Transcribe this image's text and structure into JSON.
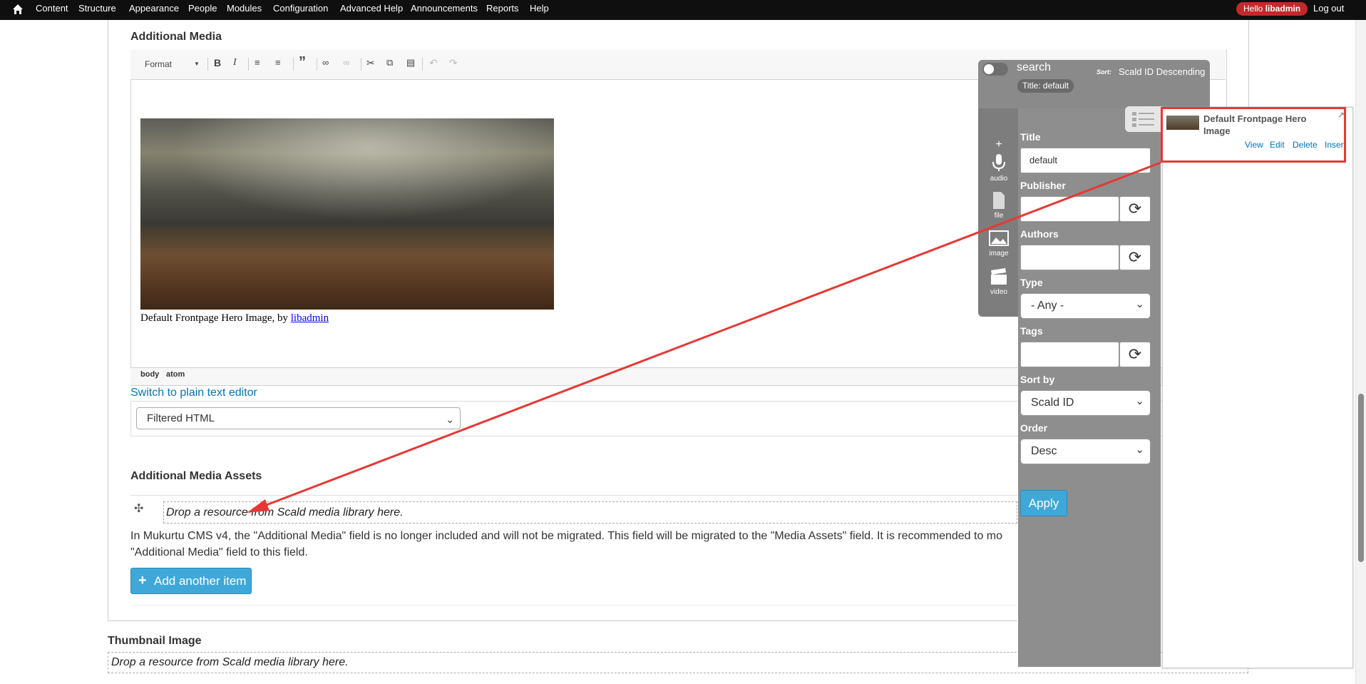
{
  "toolbar": {
    "home_icon": "home-icon",
    "items": [
      "Content",
      "Structure",
      "Appearance",
      "People",
      "Modules",
      "Configuration",
      "Advanced Help",
      "Announcements",
      "Reports",
      "Help"
    ],
    "hello_prefix": "Hello ",
    "hello_user": "libadmin",
    "logout": "Log out"
  },
  "additional_media": {
    "label": "Additional Media",
    "format_label": "Format",
    "caption_text": "Default Frontpage Hero Image, by ",
    "caption_link": "libadmin",
    "path": [
      "body",
      "atom"
    ],
    "switch_link": "Switch to plain text editor",
    "text_format": "Filtered HTML"
  },
  "assets": {
    "label": "Additional Media Assets",
    "drop_text": "Drop a resource from Scald media library here.",
    "help_line1": "In Mukurtu CMS v4, the \"Additional Media\" field is no longer included and will not be migrated. This field will be migrated to the \"Media Assets\" field. It is recommended to mo",
    "help_line2": "\"Additional Media\" field to this field.",
    "add_button": "Add another item"
  },
  "thumbnail": {
    "label": "Thumbnail Image",
    "drop_text": "Drop a resource from Scald media library here."
  },
  "scald": {
    "search_label": "search",
    "sort_prefix": "Sort:",
    "sort_value": "Scald ID Descending",
    "filter_chip": "Title: default",
    "side_items": [
      {
        "label": "",
        "icon": "plus-icon"
      },
      {
        "label": "audio",
        "icon": "microphone-icon"
      },
      {
        "label": "file",
        "icon": "file-icon"
      },
      {
        "label": "image",
        "icon": "image-icon"
      },
      {
        "label": "video",
        "icon": "clapperboard-icon"
      }
    ],
    "form": {
      "title_label": "Title",
      "title_value": "default",
      "publisher_label": "Publisher",
      "authors_label": "Authors",
      "type_label": "Type",
      "type_value": "- Any -",
      "tags_label": "Tags",
      "sortby_label": "Sort by",
      "sortby_value": "Scald ID",
      "order_label": "Order",
      "order_value": "Desc",
      "apply": "Apply"
    },
    "result": {
      "title": "Default Frontpage Hero Image",
      "links": [
        "View",
        "Edit",
        "Delete",
        "Insert"
      ]
    }
  },
  "colors": {
    "toolbar_bg": "#0f0f0f",
    "hello_badge": "#c3292b",
    "link": "#0074bd",
    "button": "#3fa8d8",
    "annotation": "#e53935"
  }
}
